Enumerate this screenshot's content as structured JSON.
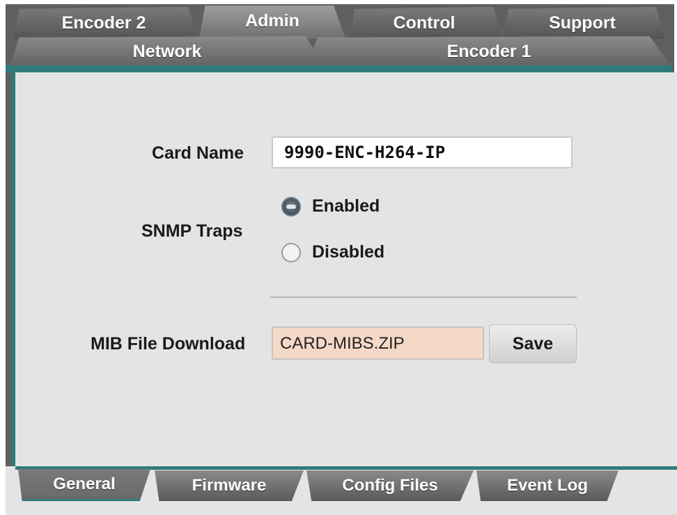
{
  "top_tabs_row1": [
    {
      "label": "Encoder 2",
      "active": false
    },
    {
      "label": "Admin",
      "active": true
    },
    {
      "label": "Control",
      "active": false
    },
    {
      "label": "Support",
      "active": false
    }
  ],
  "top_tabs_row2": [
    {
      "label": "Network",
      "active": false
    },
    {
      "label": "Encoder 1",
      "active": false
    }
  ],
  "form": {
    "card_name_label": "Card Name",
    "card_name_value": "9990-ENC-H264-IP",
    "snmp_label": "SNMP Traps",
    "snmp_options": [
      {
        "label": "Enabled",
        "selected": true
      },
      {
        "label": "Disabled",
        "selected": false
      }
    ],
    "mib_label": "MIB File Download",
    "mib_value": "CARD-MIBS.ZIP",
    "save_label": "Save"
  },
  "bottom_tabs": [
    {
      "label": "General",
      "active": true
    },
    {
      "label": "Firmware",
      "active": false
    },
    {
      "label": "Config Files",
      "active": false
    },
    {
      "label": "Event Log",
      "active": false
    }
  ],
  "colors": {
    "accent": "#2f7b7b",
    "panel_bg": "#e4e4e4",
    "tab_gray": "#6f6f6f",
    "mib_field_bg": "#f4d9c6"
  }
}
